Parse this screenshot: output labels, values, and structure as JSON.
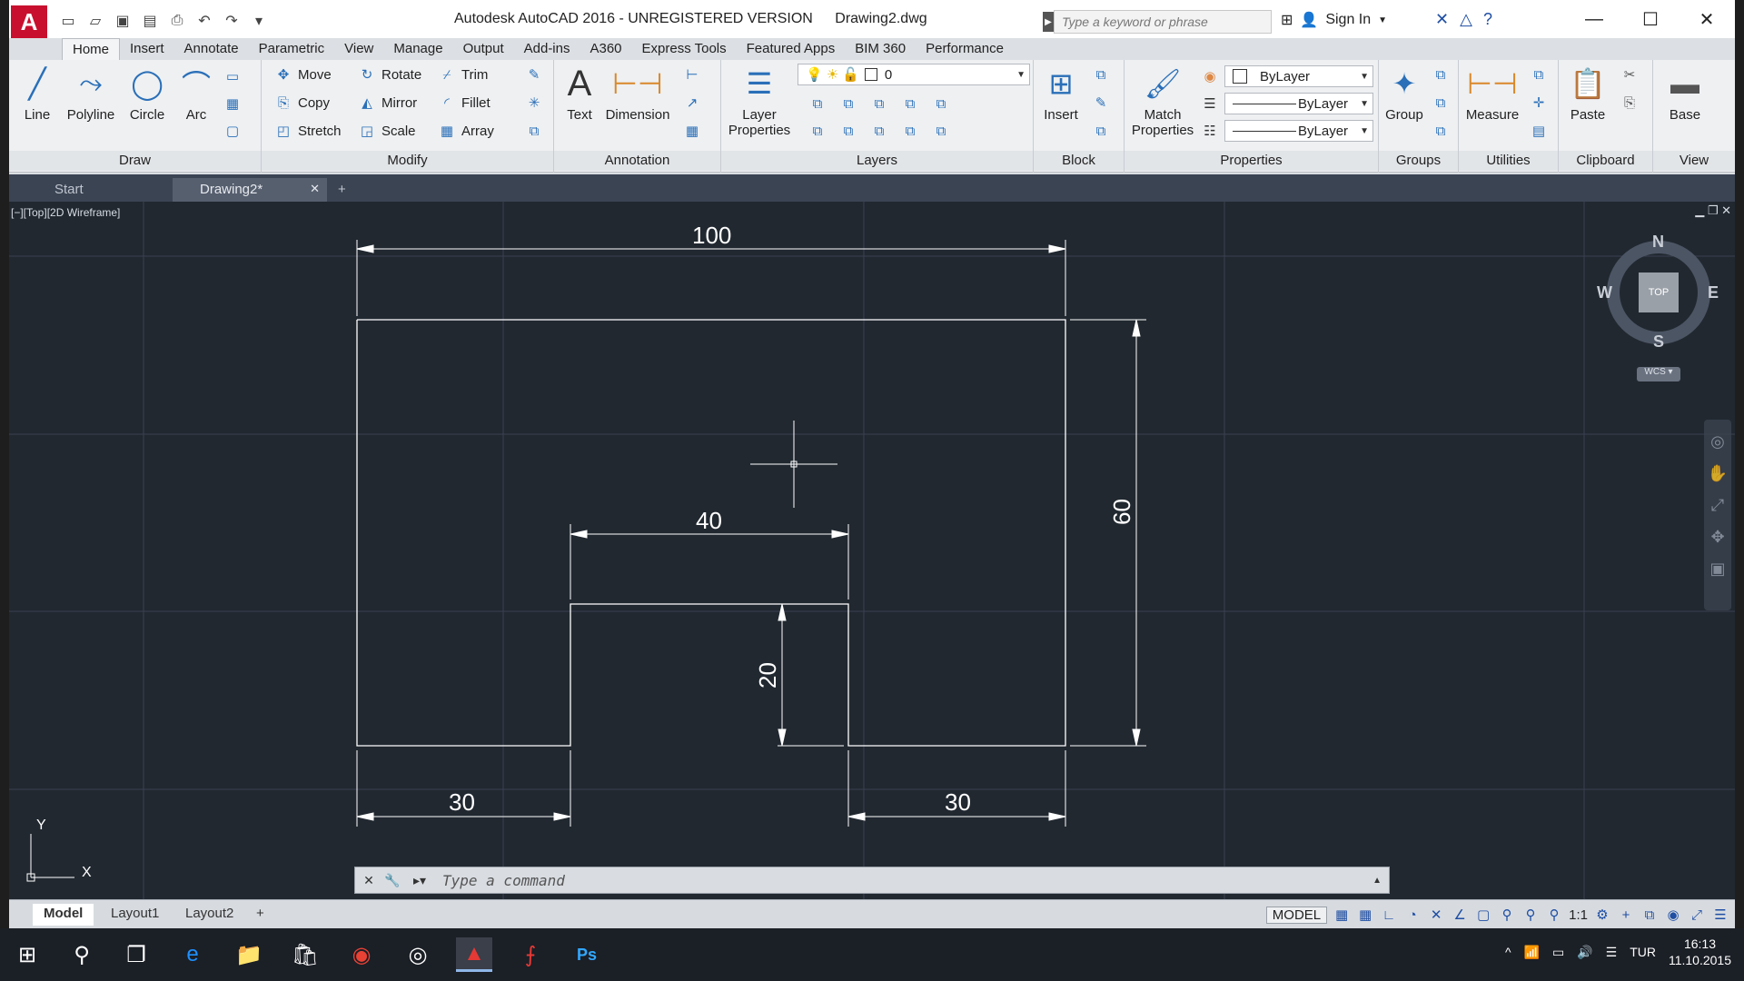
{
  "window": {
    "app_title": "Autodesk AutoCAD 2016 - UNREGISTERED VERSION",
    "file_name": "Drawing2.dwg",
    "search_placeholder": "Type a keyword or phrase",
    "sign_in": "Sign In"
  },
  "ribbon_tabs": [
    "Home",
    "Insert",
    "Annotate",
    "Parametric",
    "View",
    "Manage",
    "Output",
    "Add-ins",
    "A360",
    "Express Tools",
    "Featured Apps",
    "BIM 360",
    "Performance"
  ],
  "ribbon": {
    "draw": {
      "title": "Draw",
      "line": "Line",
      "polyline": "Polyline",
      "circle": "Circle",
      "arc": "Arc"
    },
    "modify": {
      "title": "Modify",
      "move": "Move",
      "rotate": "Rotate",
      "trim": "Trim",
      "copy": "Copy",
      "mirror": "Mirror",
      "fillet": "Fillet",
      "stretch": "Stretch",
      "scale": "Scale",
      "array": "Array"
    },
    "annotation": {
      "title": "Annotation",
      "text": "Text",
      "dimension": "Dimension"
    },
    "layers": {
      "title": "Layers",
      "layer_properties_1": "Layer",
      "layer_properties_2": "Properties",
      "current_layer": "0"
    },
    "block": {
      "title": "Block",
      "insert": "Insert"
    },
    "properties": {
      "title": "Properties",
      "match_1": "Match",
      "match_2": "Properties",
      "color": "ByLayer",
      "linetype": "ByLayer",
      "lineweight": "ByLayer"
    },
    "groups": {
      "title": "Groups",
      "group": "Group"
    },
    "utilities": {
      "title": "Utilities",
      "measure": "Measure"
    },
    "clipboard": {
      "title": "Clipboard",
      "paste": "Paste"
    },
    "view": {
      "title": "View",
      "base": "Base"
    }
  },
  "doc_tabs": {
    "start": "Start",
    "drawing": "Drawing2*"
  },
  "viewport": {
    "label": "[−][Top][2D Wireframe]",
    "viewcube": {
      "top": "TOP",
      "n": "N",
      "s": "S",
      "e": "E",
      "w": "W",
      "wcs": "WCS"
    },
    "ucs_x": "X",
    "ucs_y": "Y"
  },
  "drawing_dimensions": {
    "overall_width": "100",
    "notch_width": "40",
    "overall_height": "60",
    "notch_depth": "20",
    "left_segment": "30",
    "right_segment": "30"
  },
  "command_line": {
    "placeholder": "Type a command"
  },
  "layout_tabs": [
    "Model",
    "Layout1",
    "Layout2"
  ],
  "status": {
    "model": "MODEL",
    "scale": "1:1"
  },
  "taskbar": {
    "lang": "TUR",
    "time": "16:13",
    "date": "11.10.2015"
  },
  "colors": {
    "canvas_bg": "#212830",
    "geometry": "#ffffff",
    "accent": "#c8102e"
  }
}
